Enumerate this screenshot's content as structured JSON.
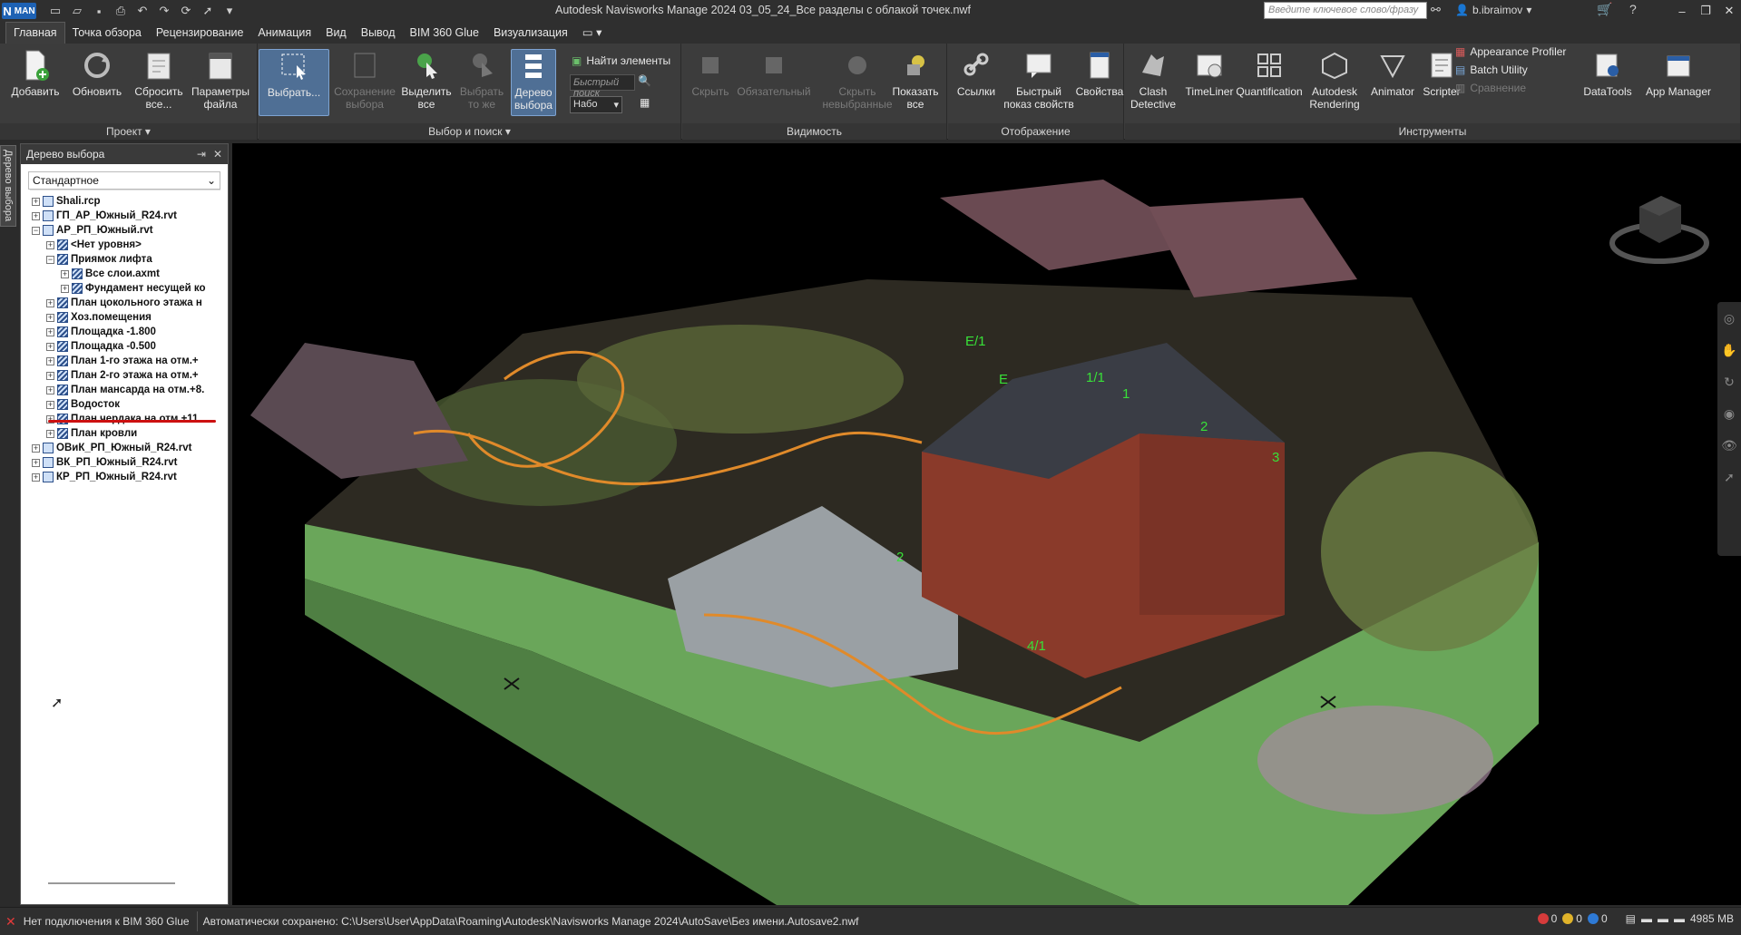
{
  "titlebar": {
    "app_badge_n": "N",
    "app_badge_text": "MAN",
    "title": "Autodesk Navisworks Manage 2024    03_05_24_Все разделы с облакой точек.nwf",
    "search_placeholder": "Введите ключевое слово/фразу",
    "user": "b.ibraimov"
  },
  "tabs": [
    "Главная",
    "Точка обзора",
    "Рецензирование",
    "Анимация",
    "Вид",
    "Вывод",
    "BIM 360 Glue",
    "Визуализация"
  ],
  "ribbon": {
    "project": {
      "title": "Проект ▾",
      "add": "Добавить",
      "refresh": "Обновить",
      "reset": "Сбросить все...",
      "file_options": "Параметры файла"
    },
    "select_search": {
      "title": "Выбор и поиск ▾",
      "select": "Выбрать...",
      "save_selection": "Сохранение выбора",
      "select_all": "Выделить все",
      "select_same": "Выбрать то же",
      "selection_tree": "Дерево выбора",
      "find_items": "Найти элементы",
      "quick_find_placeholder": "Быстрый поиск",
      "sets_value": "Набо"
    },
    "visibility": {
      "title": "Видимость",
      "hide": "Скрыть",
      "require": "Обязательный",
      "hide_unselected": "Скрыть невыбранные",
      "unhide_all": "Показать все"
    },
    "display": {
      "title": "Отображение",
      "links": "Ссылки",
      "quick_properties": "Быстрый показ свойств",
      "properties": "Свойства"
    },
    "tools": {
      "title": "Инструменты",
      "clash_detective": "Clash Detective",
      "timeliner": "TimeLiner",
      "quantification": "Quantification",
      "autodesk_rendering": "Autodesk Rendering",
      "animator": "Animator",
      "scripter": "Scripter",
      "appearance_profiler": "Appearance Profiler",
      "batch_utility": "Batch Utility",
      "compare": "Сравнение",
      "datatools": "DataTools",
      "app_manager": "App Manager"
    }
  },
  "left_tab": "Дерево выбора",
  "tree": {
    "title": "Дерево выбора",
    "mode": "Стандартное",
    "items": [
      {
        "label": "Shali.rcp",
        "depth": 0,
        "exp": "+"
      },
      {
        "label": "ГП_АР_Южный_R24.rvt",
        "depth": 0,
        "exp": "+"
      },
      {
        "label": "АР_РП_Южный.rvt",
        "depth": 0,
        "exp": "−"
      },
      {
        "label": "<Нет уровня>",
        "depth": 1,
        "exp": "+"
      },
      {
        "label": "Приямок лифта",
        "depth": 1,
        "exp": "−"
      },
      {
        "label": "Все слои.axmt",
        "depth": 2,
        "exp": "+"
      },
      {
        "label": "Фундамент несущей ко",
        "depth": 2,
        "exp": "+"
      },
      {
        "label": "План цокольного этажа н",
        "depth": 1,
        "exp": "+"
      },
      {
        "label": "Хоз.помещения",
        "depth": 1,
        "exp": "+"
      },
      {
        "label": "Площадка -1.800",
        "depth": 1,
        "exp": "+"
      },
      {
        "label": "Площадка -0.500",
        "depth": 1,
        "exp": "+"
      },
      {
        "label": "План 1-го этажа на отм.+",
        "depth": 1,
        "exp": "+"
      },
      {
        "label": "План 2-го этажа на отм.+",
        "depth": 1,
        "exp": "+"
      },
      {
        "label": "План мансарда на отм.+8.",
        "depth": 1,
        "exp": "+"
      },
      {
        "label": "Водосток",
        "depth": 1,
        "exp": "+"
      },
      {
        "label": "План чердака на отм.+11.",
        "depth": 1,
        "exp": "+"
      },
      {
        "label": "План кровли",
        "depth": 1,
        "exp": "+"
      },
      {
        "label": "ОВиК_РП_Южный_R24.rvt",
        "depth": 0,
        "exp": "+"
      },
      {
        "label": "ВК_РП_Южный_R24.rvt",
        "depth": 0,
        "exp": "+"
      },
      {
        "label": "КР_РП_Южный_R24.rvt",
        "depth": 0,
        "exp": "+"
      }
    ]
  },
  "grid_labels": [
    "E/1",
    "E",
    "1/1",
    "1",
    "2",
    "3",
    "2",
    "4/1"
  ],
  "statusbar": {
    "bim": "Нет подключения к BIM 360 Glue",
    "autosave": "Автоматически сохранено: C:\\Users\\User\\AppData\\Roaming\\Autodesk\\Navisworks Manage 2024\\AutoSave\\Без имени.Autosave2.nwf",
    "err_count": "0",
    "warn_count": "0",
    "info_count": "0",
    "memory": "4985 MB"
  }
}
